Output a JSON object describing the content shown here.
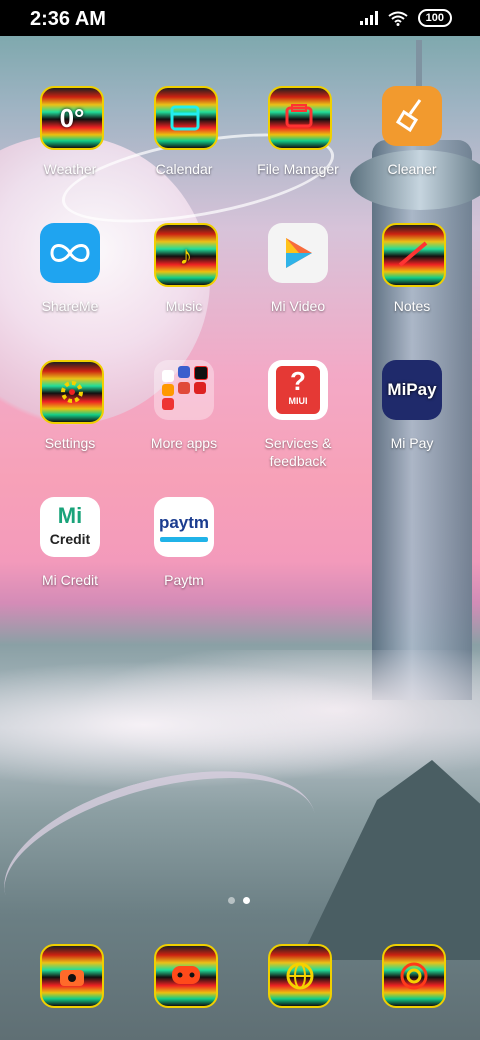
{
  "status_bar": {
    "time": "2:36 AM",
    "battery": "100",
    "icons": [
      "signal-icon",
      "wifi-icon",
      "battery-icon"
    ]
  },
  "apps": [
    {
      "label": "Weather",
      "icon": "weather-icon",
      "glyph": "0°"
    },
    {
      "label": "Calendar",
      "icon": "calendar-icon",
      "glyph": ""
    },
    {
      "label": "File Manager",
      "icon": "file-manager-icon",
      "glyph": ""
    },
    {
      "label": "Cleaner",
      "icon": "broom-icon",
      "glyph": ""
    },
    {
      "label": "ShareMe",
      "icon": "infinity-icon",
      "glyph": ""
    },
    {
      "label": "Music",
      "icon": "music-note-icon",
      "glyph": "♪"
    },
    {
      "label": "Mi Video",
      "icon": "play-icon",
      "glyph": ""
    },
    {
      "label": "Notes",
      "icon": "pen-icon",
      "glyph": ""
    },
    {
      "label": "Settings",
      "icon": "gear-icon",
      "glyph": ""
    },
    {
      "label": "More apps",
      "icon": "folder-icon",
      "glyph": ""
    },
    {
      "label": "Services & feedback",
      "icon": "help-icon",
      "glyph": "?"
    },
    {
      "label": "Mi Pay",
      "icon": "mipay-icon",
      "glyph": "Mi Pay"
    },
    {
      "label": "Mi Credit",
      "icon": "mi-credit-icon",
      "glyph": "Mi Credit"
    },
    {
      "label": "Paytm",
      "icon": "paytm-icon",
      "glyph": "Paytm"
    }
  ],
  "page_indicator": {
    "pages": 2,
    "current": 2
  },
  "dock": [
    {
      "icon": "phone-icon"
    },
    {
      "icon": "messages-icon"
    },
    {
      "icon": "browser-icon"
    },
    {
      "icon": "camera-icon"
    }
  ],
  "mi_pay": {
    "brand": "MiPay"
  },
  "paytm": {
    "brand": "paytm"
  },
  "mi_credit": {
    "brand": "Mi",
    "sub": "Credit"
  },
  "services": {
    "brand": "MIUI"
  }
}
